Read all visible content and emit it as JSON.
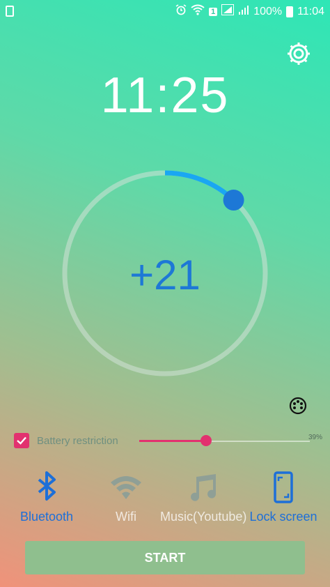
{
  "status_bar": {
    "battery_text": "100%",
    "time": "11:04",
    "sim_badge": "1",
    "icons": [
      "battery-small-icon",
      "alarm-icon",
      "wifi-icon",
      "sim-signal-icon",
      "signal-icon",
      "battery-icon"
    ]
  },
  "main": {
    "clock": "11:25",
    "offset_value": "+21",
    "ring_progress": 0.12,
    "ring_color": "#1aa7f2",
    "knob_color": "#1d78d6"
  },
  "battery": {
    "label": "Battery restriction",
    "checked": true,
    "slider_percent_text": "39%",
    "slider_value": 0.39,
    "accent": "#e2316f"
  },
  "options": [
    {
      "label": "Bluetooth",
      "icon": "bluetooth-icon",
      "active": true
    },
    {
      "label": "Wifi",
      "icon": "wifi-icon",
      "active": false
    },
    {
      "label": "Music(Youtube)",
      "icon": "music-icon",
      "active": false
    },
    {
      "label": "Lock screen",
      "icon": "lock-screen-icon",
      "active": true
    }
  ],
  "colors": {
    "active": "#1d6fd8",
    "inactive": "#8f9f96"
  },
  "start_label": "START"
}
